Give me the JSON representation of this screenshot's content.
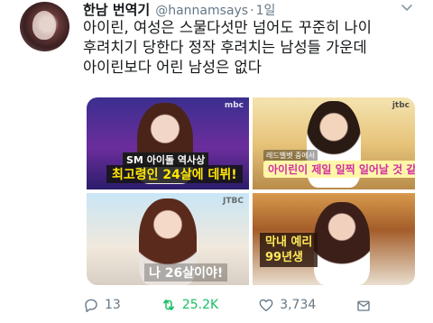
{
  "tweet": {
    "display_name": "한남 번역기",
    "handle": "@hannamsays",
    "separator": "·",
    "time": "1일",
    "text_lines": [
      "아이린, 여성은 스물다섯만 넘어도 꾸준히 나이",
      "후려치기 당한다 정작 후려치는 남성들 가운데",
      "아이린보다 어린 남성은 없다"
    ]
  },
  "media": {
    "tiles": [
      {
        "logo": "mbc",
        "caption_small": "SM 아이돌 역사상",
        "caption_main": "최고령인 24살에 데뷔!"
      },
      {
        "logo": "jtbc",
        "caption_small": "레드벨벳 중에서",
        "caption_main": "아이린이 제일 일찍 일어날 것 같아!"
      },
      {
        "logo": "JTBC",
        "caption_main": "나 26살이야!"
      },
      {
        "logo": "",
        "caption_lines": [
          "막내 예리",
          "99년생"
        ]
      }
    ]
  },
  "actions": {
    "reply_count": "13",
    "retweet_count": "25.2K",
    "like_count": "3,734"
  },
  "colors": {
    "retweet_green": "#17bf63",
    "secondary_text": "#657786"
  },
  "icons": [
    "reply-icon",
    "retweet-icon",
    "like-icon",
    "share-icon",
    "caret-down-icon"
  ]
}
